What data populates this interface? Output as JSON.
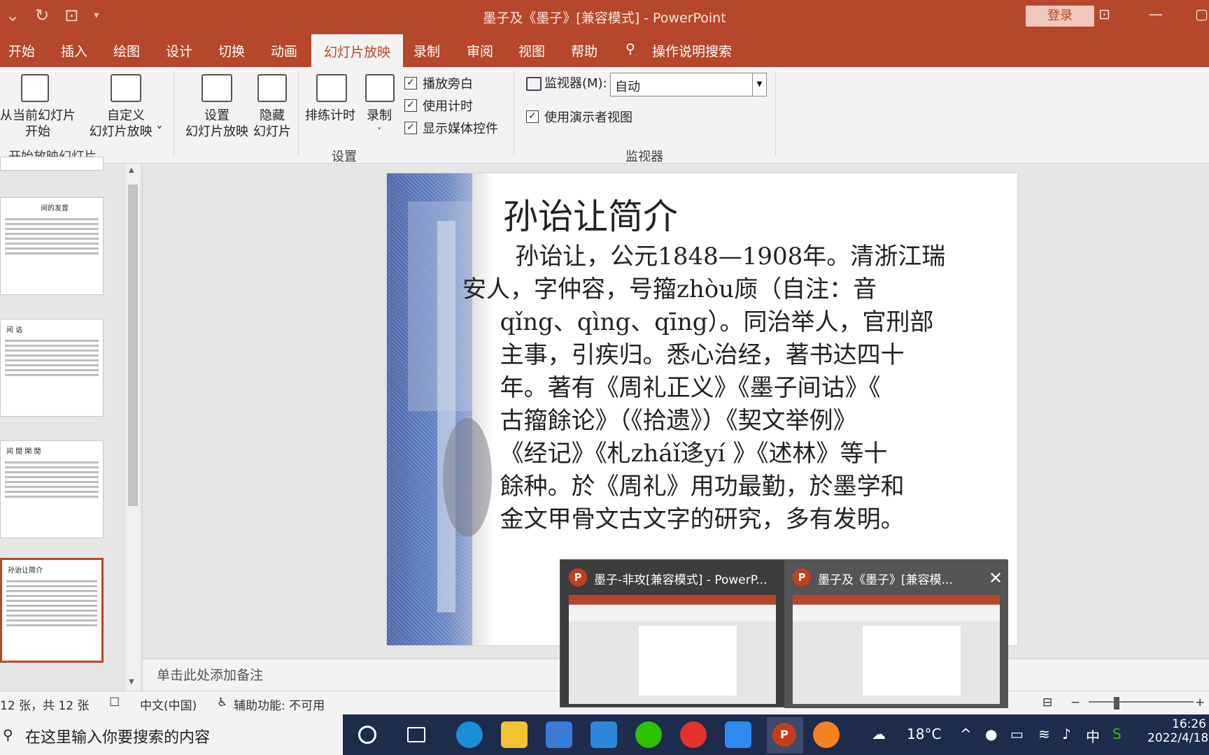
{
  "window": {
    "title": "墨子及《墨子》[兼容模式]  -  PowerPoint",
    "login_label": "登录"
  },
  "tabs": [
    "开始",
    "插入",
    "绘图",
    "设计",
    "切换",
    "动画",
    "幻灯片放映",
    "录制",
    "审阅",
    "视图",
    "帮助"
  ],
  "active_tab": "幻灯片放映",
  "tell_me": "操作说明搜索",
  "ribbon": {
    "from_current_l1": "从当前幻灯片",
    "from_current_l2": "开始",
    "custom_l1": "自定义",
    "custom_l2": "幻灯片放映 ˅",
    "group_start": "开始放映幻灯片",
    "setup_l1": "设置",
    "setup_l2": "幻灯片放映",
    "hide_l1": "隐藏",
    "hide_l2": "幻灯片",
    "rehearse": "排练计时",
    "record": "录制",
    "record_arrow": "˅",
    "chk_narration": "播放旁白",
    "chk_timing": "使用计时",
    "chk_media": "显示媒体控件",
    "group_setup": "设置",
    "monitor_label": "监视器(M):",
    "monitor_value": "自动",
    "presenter_view": "使用演示者视图",
    "group_monitor": "监视器"
  },
  "thumbnails": [
    {
      "title": "间的发音"
    },
    {
      "title": "间  诂"
    },
    {
      "title": "间  閒  閑  閒"
    },
    {
      "title": "孙诒让简介"
    }
  ],
  "slide": {
    "title": "孙诒让简介",
    "body": [
      "    孙诒让，公元1848—1908年。清浙江瑞",
      "安人，字仲容，号籀zhòu庼（自注：音",
      "  qǐng、qìng、qīng）。同治举人，官刑部",
      "  主事，引疾归。悉心治经，著书达四十",
      "  年。著有《周礼正义》《墨子间诂》《",
      "  古籀餘论》（《拾遗》）《契文举例》",
      "  《经记》《札zháǐ迻yí 》《述林》等十",
      "  餘种。於《周礼》用功最勤，於墨学和",
      "  金文甲骨文古文字的研究，多有发明。"
    ]
  },
  "notes_placeholder": "单击此处添加备注",
  "status": {
    "slide_count": "12 张，共 12 张",
    "language": "中文(中国)",
    "accessibility": "辅助功能: 不可用"
  },
  "taskbar": {
    "search_placeholder": "在这里输入你要搜索的内容",
    "temperature": "18°C",
    "ime": "中",
    "time": "16:26",
    "date": "2022/4/18"
  },
  "previews": [
    {
      "title": "墨子-非攻[兼容模式] - PowerP..."
    },
    {
      "title": "墨子及《墨子》[兼容模..."
    }
  ],
  "colors": {
    "accent": "#b7472a",
    "taskbar": "#1d2b4d"
  }
}
